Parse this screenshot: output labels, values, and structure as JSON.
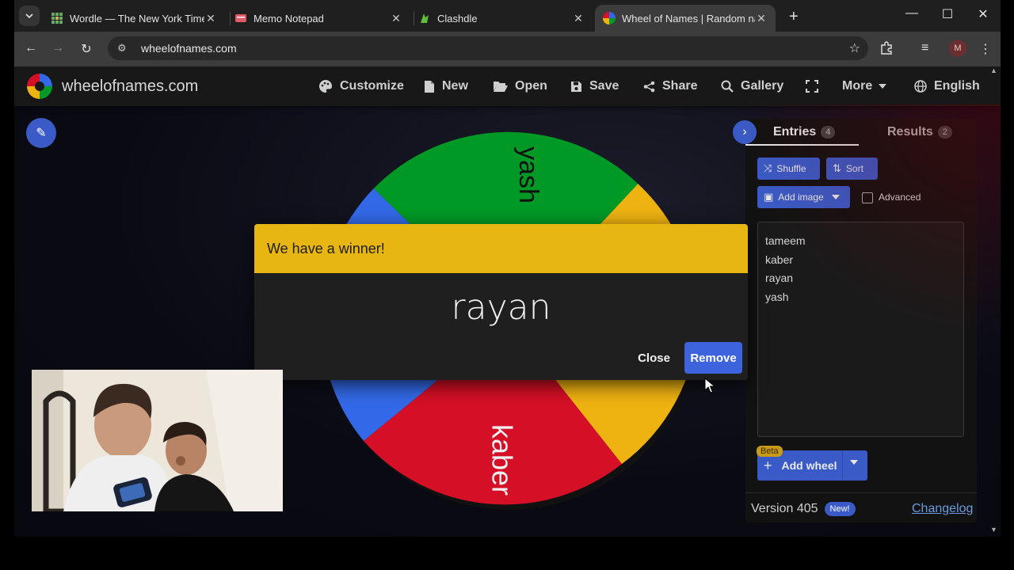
{
  "browser": {
    "tabs": [
      {
        "label": "Wordle — The New York Times",
        "icon": "wordle-grid-icon"
      },
      {
        "label": "Memo Notepad",
        "icon": "memo-icon"
      },
      {
        "label": "Clashdle",
        "icon": "clashdle-icon"
      },
      {
        "label": "Wheel of Names | Random nam",
        "icon": "wheel-icon",
        "active": true
      }
    ],
    "url": "wheelofnames.com",
    "profile_initial": "M"
  },
  "site": {
    "brand": "wheelofnames.com",
    "nav": [
      {
        "label": "Customize",
        "icon": "palette-icon"
      },
      {
        "label": "New",
        "icon": "file-icon"
      },
      {
        "label": "Open",
        "icon": "folder-open-icon"
      },
      {
        "label": "Save",
        "icon": "floppy-icon"
      },
      {
        "label": "Share",
        "icon": "share-icon"
      },
      {
        "label": "Gallery",
        "icon": "search-icon"
      },
      {
        "label": "",
        "icon": "fullscreen-icon"
      },
      {
        "label": "More",
        "icon": "caret-down-icon"
      },
      {
        "label": "English",
        "icon": "globe-icon"
      }
    ]
  },
  "wheel": {
    "segments": [
      {
        "label": "yash",
        "color": "#009925"
      },
      {
        "label": "kaber",
        "color": "#d50f25"
      },
      {
        "label": "",
        "color": "#eeb211"
      },
      {
        "label": "",
        "color": "#3369e8"
      }
    ]
  },
  "panel": {
    "tabs": {
      "entries_label": "Entries",
      "entries_count": "4",
      "results_label": "Results",
      "results_count": "2"
    },
    "shuffle_label": "Shuffle",
    "sort_label": "Sort",
    "add_image_label": "Add image",
    "advanced_label": "Advanced",
    "entries": [
      "tameem",
      "kaber",
      "rayan",
      "yash"
    ],
    "beta_label": "Beta",
    "add_wheel_label": "Add wheel",
    "version_label": "Version 405",
    "new_badge": "New!",
    "changelog_label": "Changelog"
  },
  "dialog": {
    "title": "We have a winner!",
    "winner": "rayan",
    "close_label": "Close",
    "remove_label": "Remove"
  },
  "colors": {
    "accent": "#3a5bc7",
    "dialog_header": "#e8b612"
  }
}
